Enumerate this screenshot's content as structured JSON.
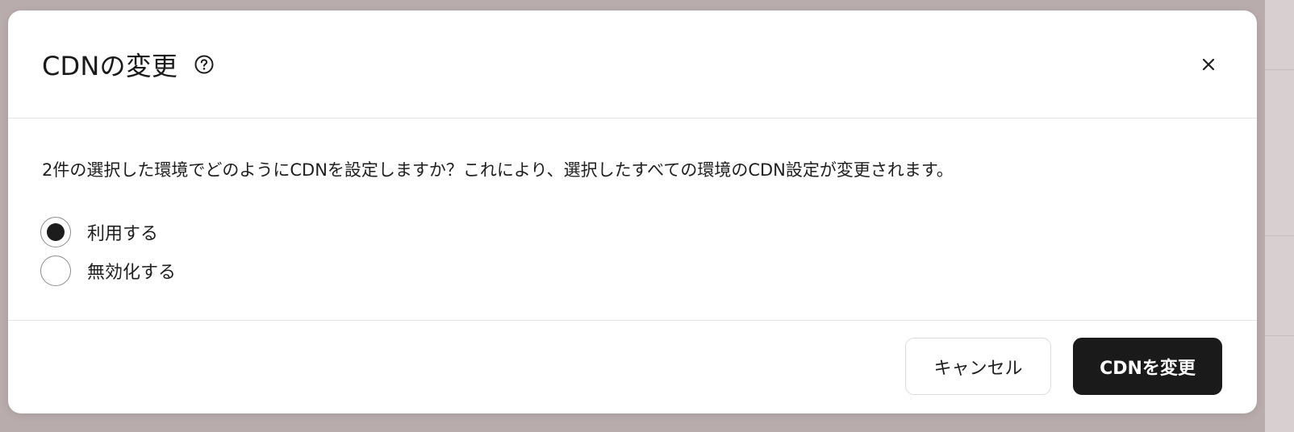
{
  "modal": {
    "title": "CDNの変更",
    "help_icon": "help-circle-icon",
    "close_icon": "close-icon"
  },
  "body": {
    "description": "2件の選択した環境でどのようにCDNを設定しますか？これにより、選択したすべての環境のCDN設定が変更されます。",
    "options": [
      {
        "label": "利用する",
        "selected": true
      },
      {
        "label": "無効化する",
        "selected": false
      }
    ]
  },
  "footer": {
    "cancel_label": "キャンセル",
    "confirm_label": "CDNを変更"
  },
  "colors": {
    "overlay": "#b9acad",
    "primary_button": "#1a1a1a",
    "primary_text": "#ffffff"
  }
}
